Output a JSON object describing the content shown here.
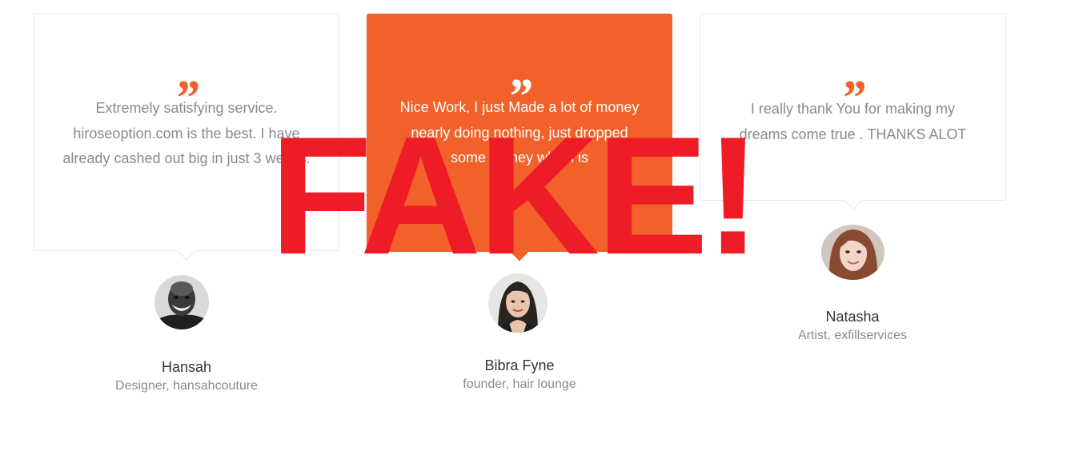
{
  "quote_mark": "”",
  "testimonials": [
    {
      "quote": "Extremely satisfying service. hiroseoption.com is the best. I have already cashed out big in just 3 weeks.",
      "name": "Hansah",
      "role": "Designer, hansahcouture",
      "avatar_icon": "avatar-bald-man-grayscale"
    },
    {
      "quote": "Nice Work, I just Made a lot of money nearly doing nothing, just dropped some money which is",
      "name": "Bibra Fyne",
      "role": "founder, hair lounge",
      "avatar_icon": "avatar-dark-haired-woman"
    },
    {
      "quote": "I really thank You for making my dreams come true . THANKS ALOT",
      "name": "Natasha",
      "role": "Artist, exfillservices",
      "avatar_icon": "avatar-red-haired-woman"
    }
  ],
  "stamp": {
    "text": "FAKE!",
    "color": "#ee1c27"
  },
  "colors": {
    "accent": "#f26129",
    "muted_text": "#8a8a8a",
    "name_text": "#333333",
    "card_border": "#e9e9e9"
  }
}
